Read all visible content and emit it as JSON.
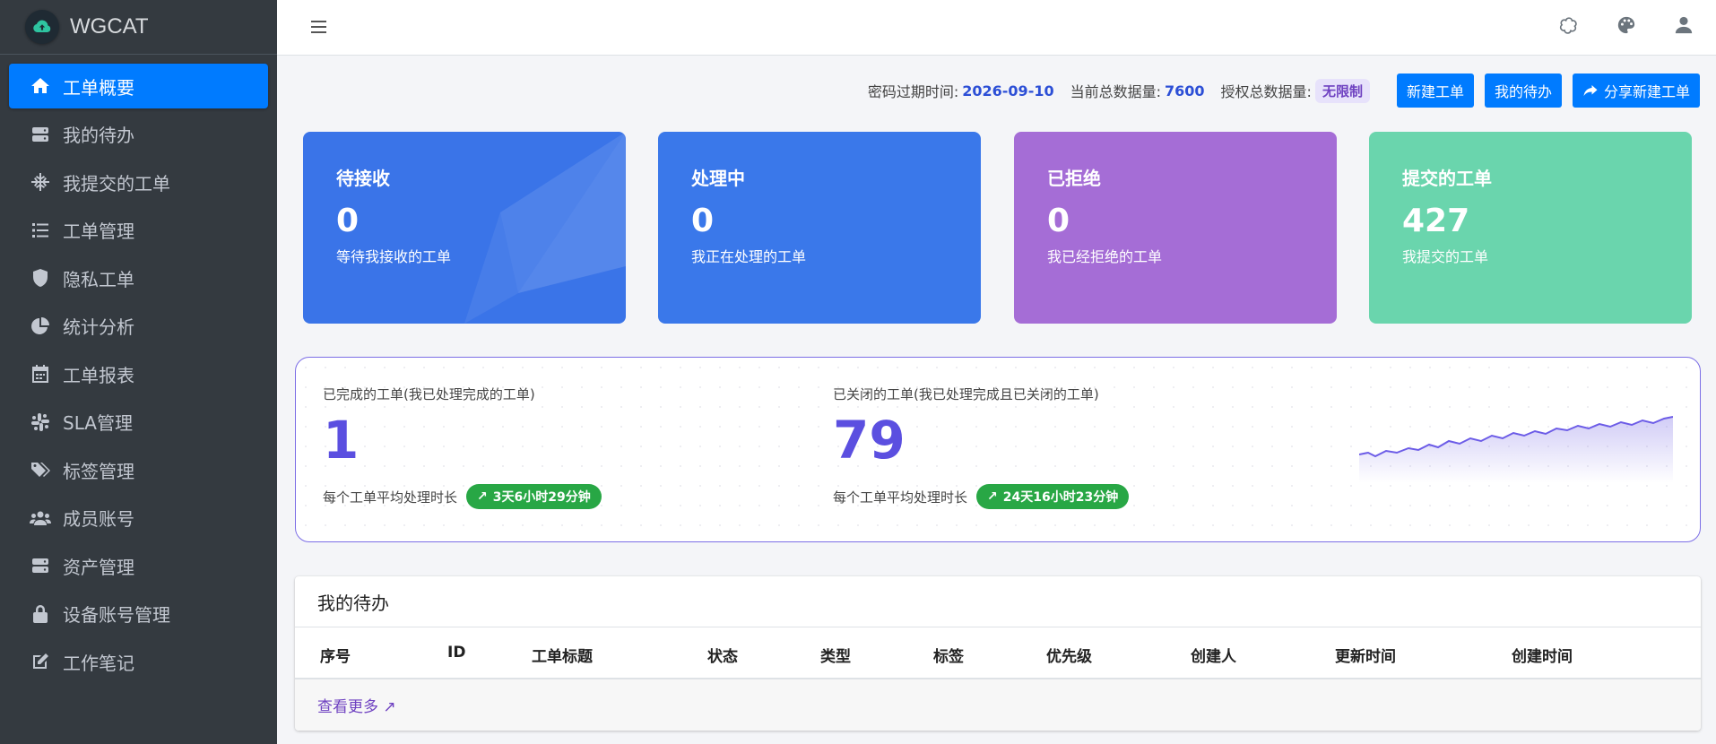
{
  "app": {
    "name": "WGCAT"
  },
  "sidebar": {
    "items": [
      {
        "label": "工单概要",
        "icon": "home-icon",
        "active": true
      },
      {
        "label": "我的待办",
        "icon": "server-icon"
      },
      {
        "label": "我提交的工单",
        "icon": "snowflake-icon"
      },
      {
        "label": "工单管理",
        "icon": "list-icon"
      },
      {
        "label": "隐私工单",
        "icon": "shield-icon"
      },
      {
        "label": "统计分析",
        "icon": "pie-chart-icon"
      },
      {
        "label": "工单报表",
        "icon": "calendar-icon"
      },
      {
        "label": "SLA管理",
        "icon": "slack-icon"
      },
      {
        "label": "标签管理",
        "icon": "tags-icon"
      },
      {
        "label": "成员账号",
        "icon": "users-icon"
      },
      {
        "label": "资产管理",
        "icon": "server-icon"
      },
      {
        "label": "设备账号管理",
        "icon": "lock-icon"
      },
      {
        "label": "工作笔记",
        "icon": "edit-icon"
      }
    ]
  },
  "topbar": {
    "icons": [
      "openai-icon",
      "palette-icon",
      "user-icon"
    ]
  },
  "info": {
    "pwd_expire_label": "密码过期时间:",
    "pwd_expire_value": "2026-09-10",
    "total_data_label": "当前总数据量:",
    "total_data_value": "7600",
    "license_label": "授权总数据量:",
    "license_value": "无限制"
  },
  "actions": {
    "new_ticket": "新建工单",
    "my_todo": "我的待办",
    "share_new_ticket": "分享新建工单"
  },
  "cards": [
    {
      "title": "待接收",
      "value": "0",
      "sub": "等待我接收的工单",
      "color": "#3a74e8"
    },
    {
      "title": "处理中",
      "value": "0",
      "sub": "我正在处理的工单",
      "color": "#3a78ea"
    },
    {
      "title": "已拒绝",
      "value": "0",
      "sub": "我已经拒绝的工单",
      "color": "#a56dd6"
    },
    {
      "title": "提交的工单",
      "value": "427",
      "sub": "我提交的工单",
      "color": "#6ad5ad"
    }
  ],
  "done": {
    "completed": {
      "label": "已完成的工单(我已处理完成的工单)",
      "value": "1",
      "avg_label": "每个工单平均处理时长",
      "avg_value": "3天6小时29分钟"
    },
    "closed": {
      "label": "已关闭的工单(我已处理完成且已关闭的工单)",
      "value": "79",
      "avg_label": "每个工单平均处理时长",
      "avg_value": "24天16小时23分钟"
    }
  },
  "todo": {
    "title": "我的待办",
    "columns": [
      "序号",
      "ID",
      "工单标题",
      "状态",
      "类型",
      "标签",
      "优先级",
      "创建人",
      "更新时间",
      "创建时间"
    ],
    "more": "查看更多 ↗"
  }
}
